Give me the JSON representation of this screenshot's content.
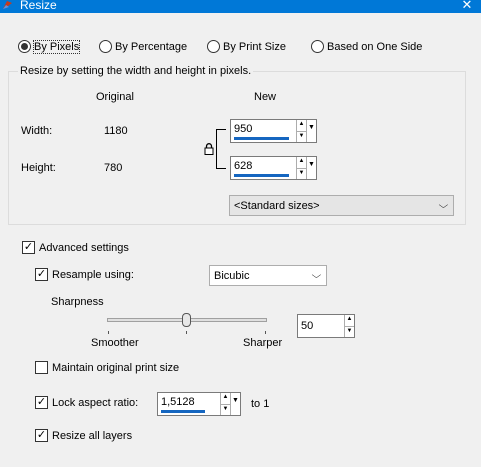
{
  "window": {
    "title": "Resize"
  },
  "resize_modes": [
    {
      "label": "By Pixels",
      "selected": true
    },
    {
      "label": "By Percentage",
      "selected": false
    },
    {
      "label": "By Print Size",
      "selected": false
    },
    {
      "label": "Based on One Side",
      "selected": false
    }
  ],
  "pixel_group": {
    "caption": "Resize by setting the width and height in pixels.",
    "original_header": "Original",
    "new_header": "New",
    "width_label": "Width:",
    "height_label": "Height:",
    "original_width": "1180",
    "original_height": "780",
    "new_width": "950",
    "new_height": "628",
    "standard_sizes": "<Standard sizes>"
  },
  "advanced": {
    "label": "Advanced settings",
    "checked": true,
    "resample_label": "Resample using:",
    "resample_checked": true,
    "resample_method": "Bicubic",
    "sharpness_label": "Sharpness",
    "smoother_label": "Smoother",
    "sharper_label": "Sharper",
    "sharpness_value": "50",
    "sharpness_level": 50,
    "maintain_print_label": "Maintain original print size",
    "maintain_print_checked": false,
    "lock_aspect_label": "Lock aspect ratio:",
    "lock_aspect_checked": true,
    "aspect_ratio": "1,5128",
    "to_label": "to 1",
    "resize_layers_label": "Resize all layers",
    "resize_layers_checked": true
  },
  "colors": {
    "titlebar": "#0078d7",
    "accent_underline": "#1566c0"
  }
}
